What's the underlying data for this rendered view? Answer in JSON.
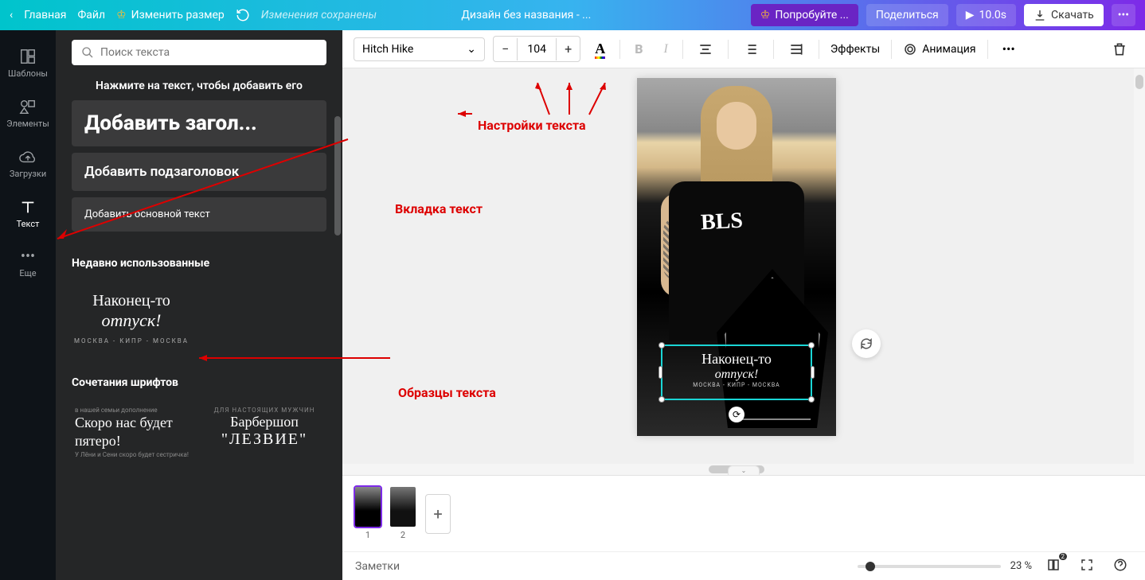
{
  "topbar": {
    "home": "Главная",
    "file": "Файл",
    "resize": "Изменить размер",
    "saved": "Изменения сохранены",
    "title": "Дизайн без названия - ...",
    "try": "Попробуйте ...",
    "share": "Поделиться",
    "duration": "10.0s",
    "download": "Скачать"
  },
  "leftnav": [
    {
      "label": "Шаблоны",
      "key": "templates"
    },
    {
      "label": "Элементы",
      "key": "elements"
    },
    {
      "label": "Загрузки",
      "key": "uploads"
    },
    {
      "label": "Текст",
      "key": "text"
    },
    {
      "label": "Еще",
      "key": "more"
    }
  ],
  "sidepanel": {
    "search_placeholder": "Поиск текста",
    "hint": "Нажмите на текст, чтобы добавить его",
    "add_heading": "Добавить загол...",
    "add_subheading": "Добавить подзаголовок",
    "add_body": "Добавить основной текст",
    "recent_title": "Недавно использованные",
    "recent": {
      "l1": "Наконец-то",
      "l2": "отпуск!",
      "l3": "МОСКВА - КИПР - МОСКВА"
    },
    "fonts_title": "Сочетания шрифтов",
    "card1": {
      "small1": "в нашей семьи дополнение",
      "big": "Скоро нас будет пятеро!",
      "small2": "У Лёни и Сени скоро будет сестричка!"
    },
    "card2": {
      "small": "ДЛЯ НАСТОЯЩИХ МУЖЧИН",
      "l1": "Барбершоп",
      "l2": "\"ЛЕЗВИЕ\""
    }
  },
  "toolbar": {
    "font": "Hitch Hike",
    "size": "104",
    "effects": "Эффекты",
    "animation": "Анимация"
  },
  "canvas": {
    "shirt": "BLS",
    "text": {
      "l1": "Наконец-то",
      "l2": "отпуск!",
      "l3": "МОСКВА - КИПР - МОСКВА"
    }
  },
  "annotations": {
    "a1": "Настройки текста",
    "a2": "Вкладка текст",
    "a3": "Образцы текста"
  },
  "footer": {
    "page1": "1",
    "page2": "2",
    "notes": "Заметки",
    "zoom": "23 %",
    "pages_badge": "2"
  }
}
